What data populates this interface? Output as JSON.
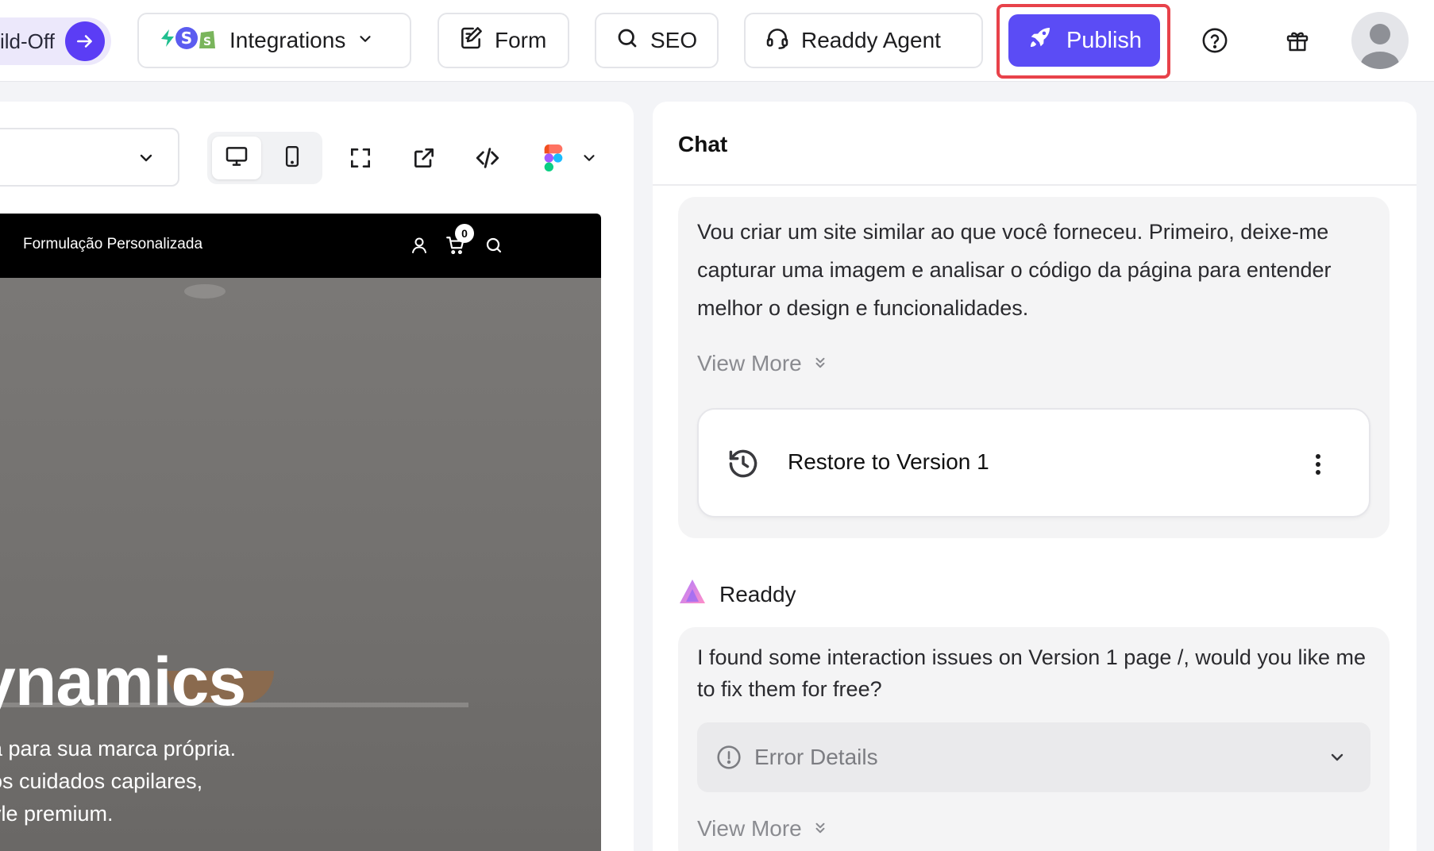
{
  "topbar": {
    "build_off_label": "ild-Off",
    "integrations_label": "Integrations",
    "form_label": "Form",
    "seo_label": "SEO",
    "agent_label": "Readdy Agent",
    "publish_label": "Publish"
  },
  "preview": {
    "site": {
      "brand": "Formulação Personalizada",
      "cart_count": "0",
      "hero_title": "ynamics",
      "hero_lines": [
        "a para sua marca própria.",
        "os cuidados capilares,",
        "yle premium."
      ]
    }
  },
  "chat": {
    "title": "Chat",
    "messages": [
      {
        "text": "Vou criar um site similar ao que você forneceu. Primeiro, deixe-me capturar uma imagem e analisar o código da página para entender melhor o design e funcionalidades.",
        "view_more": "View More",
        "restore_label": "Restore to Version 1"
      }
    ],
    "sender": "Readdy",
    "reply": {
      "text": "I found some interaction issues on Version 1 page /, would you like me to fix them for free?",
      "error_label": "Error Details",
      "view_more": "View More"
    }
  },
  "colors": {
    "accent": "#5b4cf5",
    "highlight_border": "#e8424a"
  }
}
